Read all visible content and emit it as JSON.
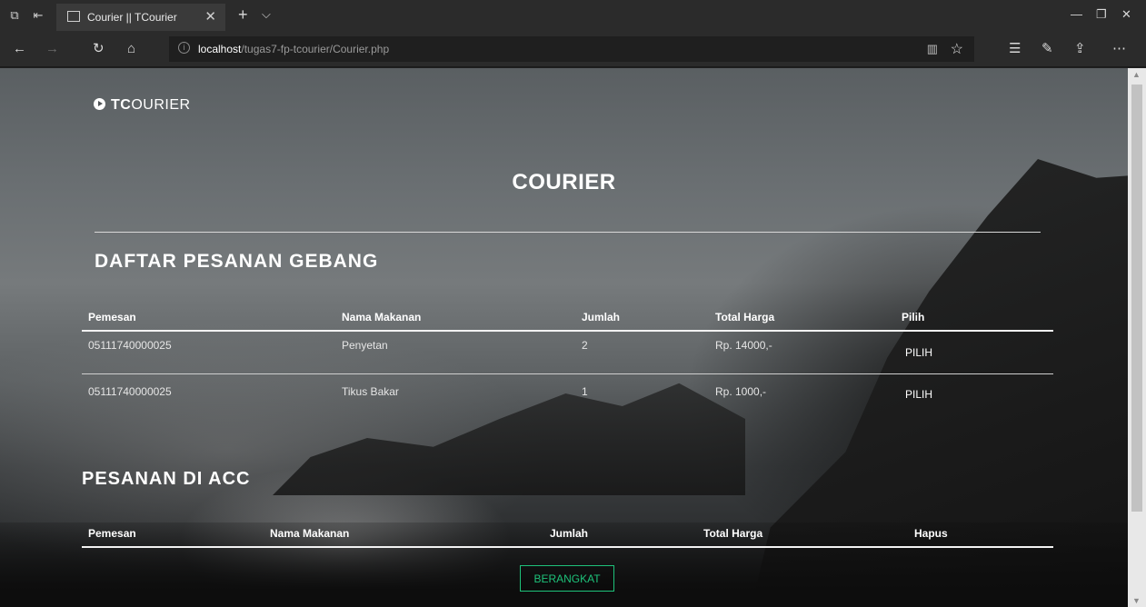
{
  "browser": {
    "tab_title": "Courier || TCourier",
    "url_host": "localhost",
    "url_path": "/tugas7-fp-tcourier/Courier.php"
  },
  "brand": {
    "bold": "TC",
    "rest": "OURIER"
  },
  "page": {
    "title": "COURIER"
  },
  "orders": {
    "title": "DAFTAR PESANAN GEBANG",
    "headers": [
      "Pemesan",
      "Nama Makanan",
      "Jumlah",
      "Total Harga",
      "Pilih"
    ],
    "rows": [
      {
        "pemesan": "05111740000025",
        "nama_makanan": "Penyetan",
        "jumlah": "2",
        "total_harga": "Rp. 14000,-",
        "action": "PILIH"
      },
      {
        "pemesan": "05111740000025",
        "nama_makanan": "Tikus Bakar",
        "jumlah": "1",
        "total_harga": "Rp. 1000,-",
        "action": "PILIH"
      }
    ]
  },
  "accepted": {
    "title": "PESANAN DI ACC",
    "headers": [
      "Pemesan",
      "Nama Makanan",
      "Jumlah",
      "Total Harga",
      "Hapus"
    ],
    "submit_label": "BERANGKAT"
  },
  "colors": {
    "accent_button": "#1ec27a"
  }
}
